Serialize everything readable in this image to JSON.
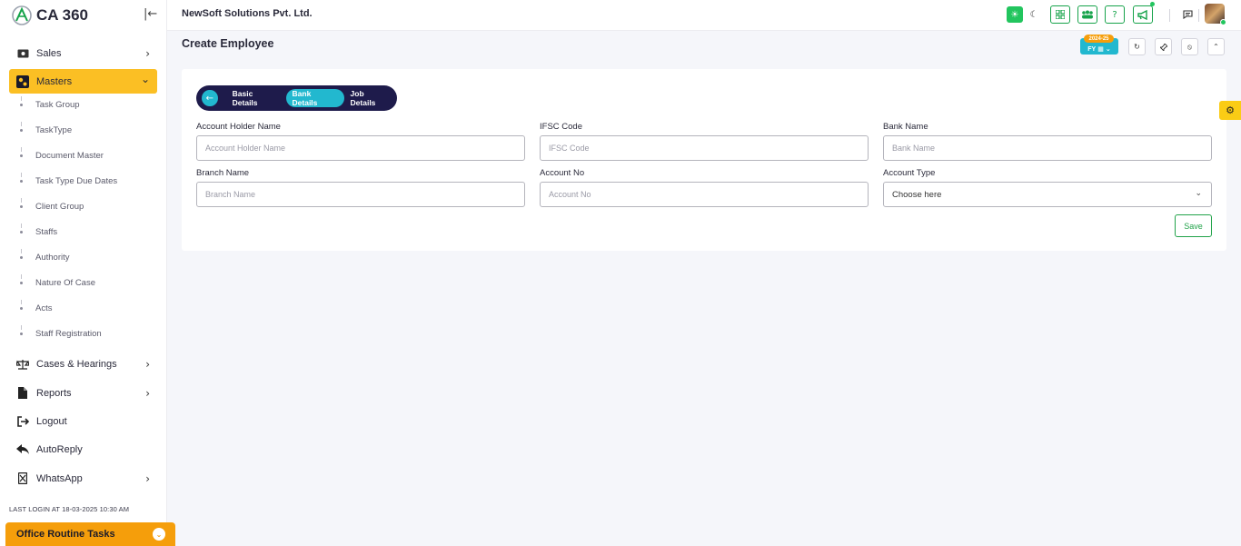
{
  "app": {
    "logo_text": "CA 360",
    "company": "NewSoft Solutions Pvt. Ltd."
  },
  "sidebar": {
    "items": [
      {
        "label": "Sales",
        "icon": "money-icon",
        "chevron": "›"
      },
      {
        "label": "Masters",
        "icon": "gears-icon",
        "chevron": "⌄"
      },
      {
        "label": "Cases & Hearings",
        "icon": "scale-icon",
        "chevron": "›"
      },
      {
        "label": "Reports",
        "icon": "file-icon",
        "chevron": "›"
      },
      {
        "label": "Logout",
        "icon": "logout-icon"
      },
      {
        "label": "AutoReply",
        "icon": "reply-icon"
      },
      {
        "label": "WhatsApp",
        "icon": "whatsapp-icon",
        "chevron": "›"
      }
    ],
    "masters_sub": [
      "Task Group",
      "TaskType",
      "Document Master",
      "Task Type Due Dates",
      "Client Group",
      "Staffs",
      "Authority",
      "Nature Of Case",
      "Acts",
      "Staff Registration"
    ],
    "last_login": "LAST LOGIN AT 18-03-2025 10:30 AM",
    "routine_tasks": "Office Routine Tasks"
  },
  "page": {
    "title": "Create Employee",
    "fy_label": "FY",
    "fy_year": "2024-25"
  },
  "stepper": {
    "steps": [
      "Basic Details",
      "Bank Details",
      "Job Details"
    ],
    "active": "Bank Details"
  },
  "form": {
    "account_holder": {
      "label": "Account Holder Name",
      "placeholder": "Account Holder Name",
      "value": ""
    },
    "ifsc": {
      "label": "IFSC Code",
      "placeholder": "IFSC Code",
      "value": ""
    },
    "bank_name": {
      "label": "Bank Name",
      "placeholder": "Bank Name",
      "value": ""
    },
    "branch_name": {
      "label": "Branch Name",
      "placeholder": "Branch Name",
      "value": ""
    },
    "account_no": {
      "label": "Account No",
      "placeholder": "Account No",
      "value": ""
    },
    "account_type": {
      "label": "Account Type",
      "selected": "Choose here"
    },
    "save_label": "Save"
  },
  "colors": {
    "accent_yellow": "#fbbf24",
    "stepper_bg": "#1e1b4b",
    "stepper_active": "#22b8cf",
    "green": "#16a34a",
    "orange": "#f59e0b"
  }
}
